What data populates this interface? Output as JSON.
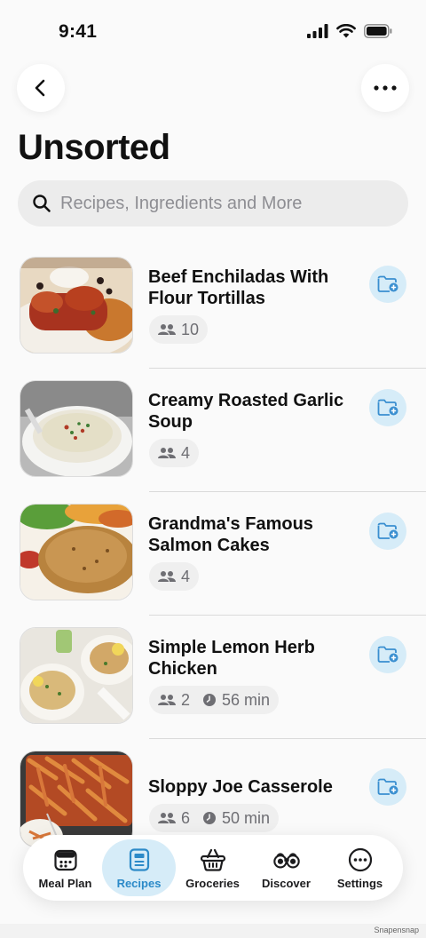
{
  "status_bar": {
    "time": "9:41"
  },
  "page": {
    "title": "Unsorted"
  },
  "search": {
    "placeholder": "Recipes, Ingredients and More"
  },
  "recipes": [
    {
      "title": "Beef Enchiladas With Flour Tortillas",
      "servings": "10",
      "time": null
    },
    {
      "title": "Creamy Roasted Garlic Soup",
      "servings": "4",
      "time": null
    },
    {
      "title": "Grandma's Famous Salmon Cakes",
      "servings": "4",
      "time": null
    },
    {
      "title": "Simple Lemon Herb Chicken",
      "servings": "2",
      "time": "56 min"
    },
    {
      "title": "Sloppy Joe Casserole",
      "servings": "6",
      "time": "50 min"
    }
  ],
  "tab_bar": {
    "active": "Recipes",
    "tabs": [
      {
        "label": "Meal Plan",
        "icon": "meal-plan-icon"
      },
      {
        "label": "Recipes",
        "icon": "recipe-book-icon"
      },
      {
        "label": "Groceries",
        "icon": "basket-icon"
      },
      {
        "label": "Discover",
        "icon": "binoculars-icon"
      },
      {
        "label": "Settings",
        "icon": "more-circle-icon"
      }
    ]
  },
  "watermark": "Snapensnap",
  "colors": {
    "accent": "#2c8ac8",
    "accent_bg": "#d6ecf8",
    "background": "#fafafa"
  }
}
